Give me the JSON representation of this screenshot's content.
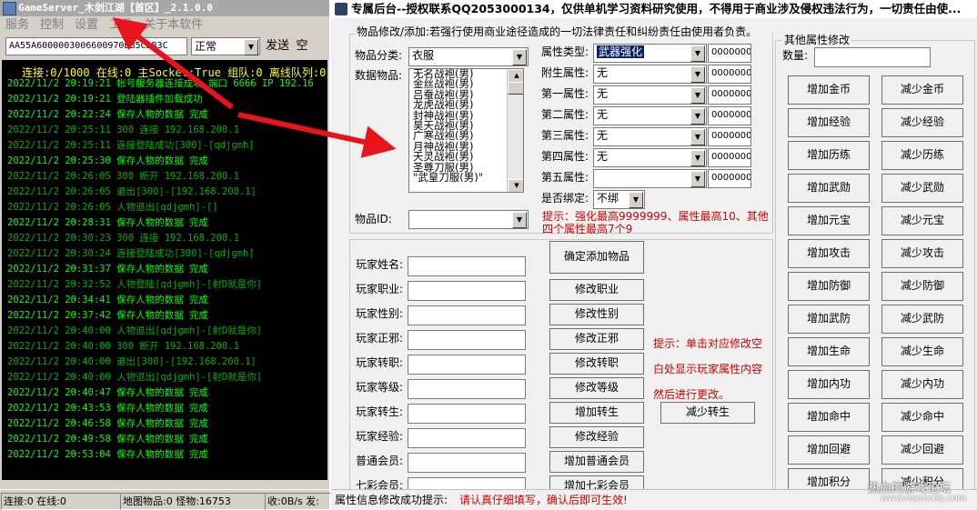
{
  "left": {
    "title": "GameServer_木剑江湖【首区】_2.1.0.0",
    "menu": [
      "服务",
      "控制",
      "设置",
      "工具",
      "关于本软件"
    ],
    "command_value": "AA55A6000003006600970",
    "command_tail": "BB5CDB3C",
    "mode_value": "正常",
    "send_label": "发送",
    "space_label": "空",
    "console_header": "连接:0/1000  在线:0  主Socket:True 组队:0 离线队列:0 数据",
    "log": [
      {
        "t": "2022/11/2  20:19:21 帐号服务器连接成功 端口 6666 IP 192.16",
        "c": "#00ff00"
      },
      {
        "t": "2022/11/2  20:19:21 登陆器插件加载成功",
        "c": "#00ff00"
      },
      {
        "t": "2022/11/2  20:22:24 保存人物的数据 完成",
        "c": "#00ff00"
      },
      {
        "t": "2022/11/2  20:25:11 300 连接 192.168.200.1",
        "c": "#00b000"
      },
      {
        "t": "2022/11/2  20:25:11 连接登陆成功[300]-[qdjgmh]",
        "c": "#00b000"
      },
      {
        "t": "2022/11/2  20:25:30 保存人物的数据 完成",
        "c": "#00ff00"
      },
      {
        "t": "2022/11/2  20:26:05 300 断开 192.168.200.1",
        "c": "#00b000"
      },
      {
        "t": "2022/11/2  20:26:05 退出[300]-[192.168.200.1]",
        "c": "#00b000"
      },
      {
        "t": "2022/11/2  20:26:05 人物退出[qdjgmh]-[]",
        "c": "#00b000"
      },
      {
        "t": "2022/11/2  20:28:31 保存人物的数据 完成",
        "c": "#00ff00"
      },
      {
        "t": "2022/11/2  20:30:23 300 连接 192.168.200.1",
        "c": "#00b000"
      },
      {
        "t": "2022/11/2  20:30:24 连接登陆成功[300]-[qdjgmh]",
        "c": "#00b000"
      },
      {
        "t": "2022/11/2  20:31:37 保存人物的数据 完成",
        "c": "#00ff00"
      },
      {
        "t": "2022/11/2  20:32:52 人物登陆[qdjgmh]-[射D就是你]",
        "c": "#00b000"
      },
      {
        "t": "2022/11/2  20:34:41 保存人物的数据 完成",
        "c": "#00ff00"
      },
      {
        "t": "2022/11/2  20:37:42 保存人物的数据 完成",
        "c": "#00ff00"
      },
      {
        "t": "2022/11/2  20:40:00 人物退出[qdjgmh]-[射D就是你]",
        "c": "#00b000"
      },
      {
        "t": "2022/11/2  20:40:00 300 断开 192.168.200.1",
        "c": "#00b000"
      },
      {
        "t": "2022/11/2  20:40:00 退出[300]-[192.168.200.1]",
        "c": "#00b000"
      },
      {
        "t": "2022/11/2  20:40:00 人物退出[qdjgmh]-[射D就是你]",
        "c": "#00b000"
      },
      {
        "t": "2022/11/2  20:40:47 保存人物的数据 完成",
        "c": "#00ff00"
      },
      {
        "t": "2022/11/2  20:43:53 保存人物的数据 完成",
        "c": "#00ff00"
      },
      {
        "t": "2022/11/2  20:46:58 保存人物的数据 完成",
        "c": "#00ff00"
      },
      {
        "t": "2022/11/2  20:49:58 保存人物的数据 完成",
        "c": "#00ff00"
      },
      {
        "t": "2022/11/2  20:53:04 保存人物的数据 完成",
        "c": "#00ff00"
      }
    ],
    "status": {
      "conn": "连接:0 在线:0",
      "map": "地图物品:0 怪物:16753",
      "rate": "收:0B/s 发:"
    }
  },
  "right": {
    "title": "专属后台--授权联系QQ2053000134，仅供单机学习资料研究使用，不得用于商业涉及侵权违法行为，一切责任由使...",
    "item_group": {
      "legend": "物品修改/添加:若强行使用商业途径造成的一切法律责任和纠纷责任由使用者负责。",
      "category_label": "物品分类:",
      "category_value": "衣服",
      "data_label": "数据物品:",
      "items": [
        "无名战袍(男)",
        "金丝战袍(男)",
        "吕蚕战袍(男)",
        "龙虎战袍(男)",
        "封神战袍(男)",
        "昊天战袍(男)",
        "广寒战袍(男)",
        "月神战袍(男)",
        "天灵战袍(男)",
        "圣尊刀服(男)",
        "\"武皇刀服(男)\""
      ],
      "item_id_label": "物品ID:",
      "attr_type_label": "属性类型:",
      "attr_type_value": "武器强化",
      "attrs": [
        {
          "label": "附生属性:",
          "value": "无"
        },
        {
          "label": "第一属性:",
          "value": "无"
        },
        {
          "label": "第二属性:",
          "value": "无"
        },
        {
          "label": "第三属性:",
          "value": "无"
        },
        {
          "label": "第四属性:",
          "value": "无"
        },
        {
          "label": "第五属性:",
          "value": ""
        }
      ],
      "num_values": [
        "0000000",
        "0000000",
        "0000000",
        "0000000",
        "0000000",
        "0000000",
        "0000000"
      ],
      "bind_label": "是否绑定:",
      "bind_value": "不绑",
      "hint": "提示：强化最高9999999、属性最高10、其他四个属性最高7个9"
    },
    "player": {
      "fields": [
        "玩家姓名:",
        "玩家职业:",
        "玩家性别:",
        "玩家正邪:",
        "玩家转职:",
        "玩家等级:",
        "玩家转生:",
        "玩家经验:",
        "普通会员:",
        "七彩会员:"
      ],
      "add_item_button": "确定添加物品",
      "buttons": [
        "修改职业",
        "修改性别",
        "修改正邪",
        "修改转职",
        "修改等级",
        "增加转生",
        "修改经验",
        "增加普通会员",
        "增加七彩会员"
      ],
      "reduce_rebirth": "减少转生",
      "hint_lines": [
        "提示：单击对应修改空",
        "白处显示玩家属性内容",
        "然后进行更改。"
      ]
    },
    "other_group": {
      "legend": "其他属性修改",
      "qty_label": "数量:",
      "add": [
        "增加金币",
        "增加经验",
        "增加历练",
        "增加武勋",
        "增加元宝",
        "增加攻击",
        "增加防御",
        "增加武防",
        "增加生命",
        "增加内功",
        "增加命中",
        "增加回避",
        "增加积分"
      ],
      "sub": [
        "减少金币",
        "减少经验",
        "减少历练",
        "减少武勋",
        "减少元宝",
        "减少攻击",
        "减少防御",
        "减少武防",
        "减少生命",
        "减少内功",
        "减少命中",
        "减少回避",
        "减少积分"
      ]
    },
    "status_label": "属性信息修改成功提示:",
    "status_msg": "请认真仔细填写，确认后即可生效!",
    "watermark": "热血的游戏论坛",
    "watermark_url": "www.rexuexia.com"
  },
  "colors": {
    "arrow": "#e8141c",
    "hint": "#d00000",
    "console_bg": "#000000"
  }
}
